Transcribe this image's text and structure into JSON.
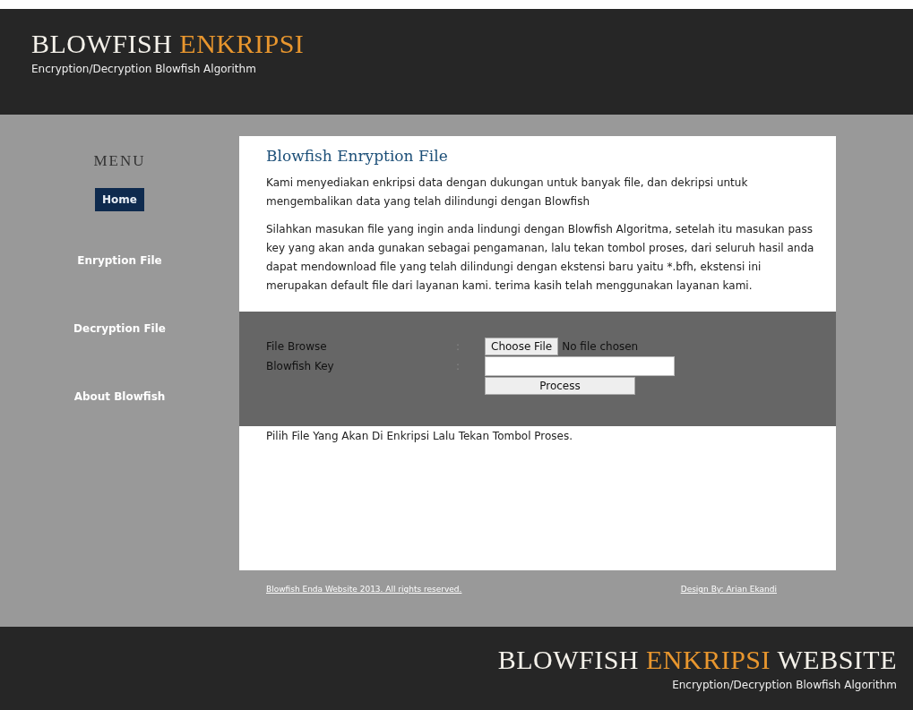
{
  "header": {
    "logo": [
      {
        "text": "BLOWFISH",
        "highlight": false
      },
      {
        "text": "ENKRIPSI",
        "highlight": true
      }
    ],
    "tagline": "Encryption/Decryption Blowfish Algorithm"
  },
  "menu": {
    "title": "MENU",
    "items": [
      {
        "label": "Home",
        "selected": true
      },
      {
        "label": "Enryption File",
        "selected": false
      },
      {
        "label": "Decryption File",
        "selected": false
      },
      {
        "label": "About Blowfish",
        "selected": false
      }
    ]
  },
  "content": {
    "title": "Blowfish Enryption File",
    "paragraphs": [
      "Kami menyediakan enkripsi data dengan dukungan untuk banyak file, dan dekripsi untuk mengembalikan data yang telah dilindungi dengan Blowfish",
      "Silahkan masukan file yang ingin anda lindungi dengan Blowfish Algoritma, setelah itu masukan pass key yang akan anda gunakan sebagai pengamanan, lalu tekan tombol proses, dari seluruh hasil anda dapat mendownload file yang telah dilindungi dengan ekstensi baru yaitu *.bfh, ekstensi ini merupakan default file dari layanan kami. terima kasih telah menggunakan layanan kami."
    ],
    "form": {
      "file_label": "File Browse",
      "key_label": "Blowfish Key",
      "separator": ":",
      "choose_button": "Choose File",
      "file_status": "No file chosen",
      "process_button": "Process"
    },
    "hint": "Pilih File Yang Akan Di Enkripsi Lalu Tekan Tombol Proses."
  },
  "page_footer": {
    "copyright": "Blowfish Enda Website 2013. All rights reserved.",
    "credit": "Design By: Arian Ekandi"
  },
  "footer": {
    "logo": [
      {
        "text": "BLOWFISH",
        "highlight": false
      },
      {
        "text": "ENKRIPSI",
        "highlight": true
      },
      {
        "text": "WEBSITE",
        "highlight": false
      }
    ],
    "tagline": "Encryption/Decryption Blowfish Algorithm"
  }
}
